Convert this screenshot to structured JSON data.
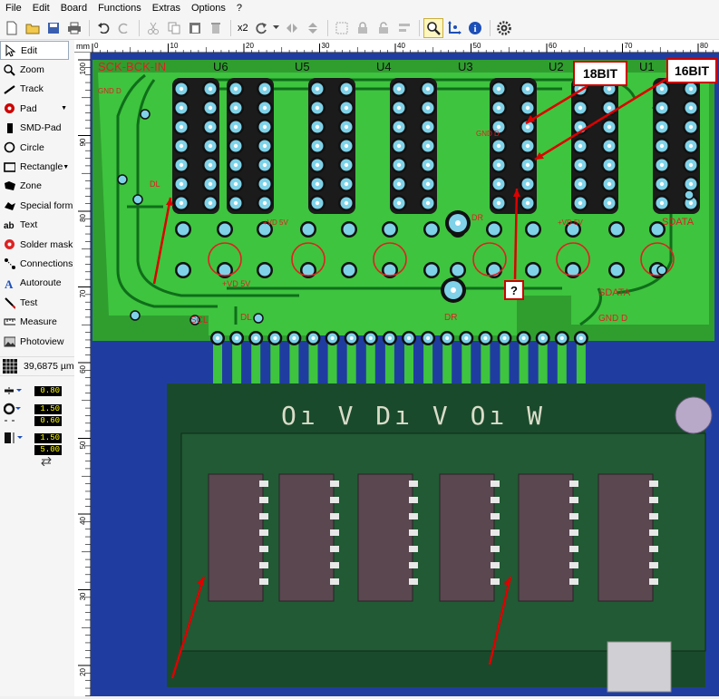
{
  "menu": [
    "File",
    "Edit",
    "Board",
    "Functions",
    "Extras",
    "Options",
    "?"
  ],
  "toolbar": {
    "multiplier": "x2"
  },
  "tools": [
    {
      "label": "Edit",
      "icon": "cursor-arrow-icon",
      "active": true
    },
    {
      "label": "Zoom",
      "icon": "zoom-icon"
    },
    {
      "label": "Track",
      "icon": "track-icon"
    },
    {
      "label": "Pad",
      "icon": "pad-icon",
      "dropdown": true
    },
    {
      "label": "SMD-Pad",
      "icon": "smd-pad-icon"
    },
    {
      "label": "Circle",
      "icon": "circle-icon"
    },
    {
      "label": "Rectangle",
      "icon": "rectangle-icon",
      "dropdown": true
    },
    {
      "label": "Zone",
      "icon": "zone-icon"
    },
    {
      "label": "Special form",
      "icon": "special-form-icon"
    },
    {
      "label": "Text",
      "icon": "text-icon"
    },
    {
      "label": "Solder mask",
      "icon": "solder-mask-icon"
    },
    {
      "label": "Connections",
      "icon": "connections-icon"
    },
    {
      "label": "Autoroute",
      "icon": "autoroute-icon"
    },
    {
      "label": "Test",
      "icon": "test-icon"
    },
    {
      "label": "Measure",
      "icon": "measure-icon"
    },
    {
      "label": "Photoview",
      "icon": "photoview-icon"
    }
  ],
  "grid": {
    "value": "39,6875 µm"
  },
  "params": {
    "track_width": "0.80",
    "pad_outer": "1.50",
    "pad_inner": "0.60",
    "smd_width": "1.50",
    "smd_height": "5.00"
  },
  "ruler": {
    "unit": "mm",
    "top_ticks": [
      "0",
      "10",
      "20",
      "30",
      "40",
      "50",
      "60",
      "70",
      "80"
    ],
    "left_ticks": [
      "100",
      "90",
      "80",
      "70",
      "60",
      "50",
      "40",
      "30",
      "20"
    ]
  },
  "board": {
    "title": "SCK-BCK-IN",
    "ics": [
      "U6",
      "U5",
      "U4",
      "U3",
      "U2",
      "U1"
    ],
    "labels": [
      "GND D",
      "GND D",
      "+VD 5V",
      "+VD 5V",
      "+VD 5V",
      "DR",
      "DR",
      "DL",
      "DL",
      "SDATA",
      "SDATA",
      "GND D",
      "DR",
      "SCL"
    ],
    "callouts": [
      "18BIT",
      "16BIT",
      "?"
    ],
    "photo_silk": "Oı V Dı V Oı W"
  },
  "colors": {
    "board": "#2f9e2f",
    "copper": "#3ec43e",
    "background": "#1f3da0",
    "pad": "#7fd2e8",
    "silk": "#e02020"
  }
}
